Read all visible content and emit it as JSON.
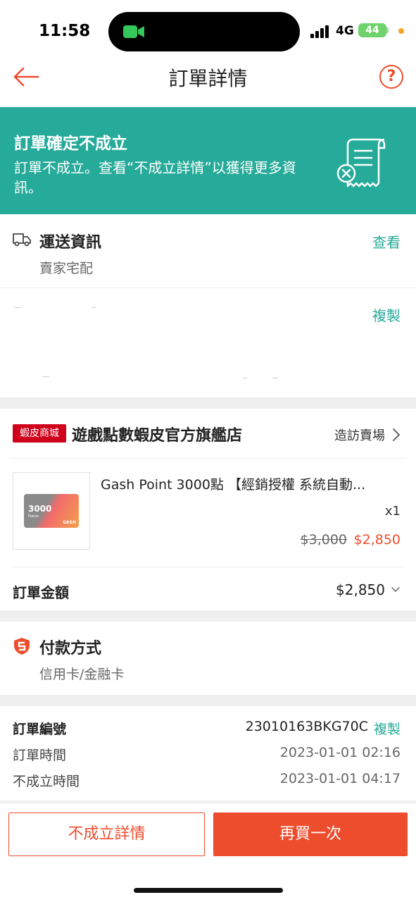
{
  "status_bar": {
    "time": "11:58",
    "network": "4G",
    "battery": "44",
    "icons": [
      "facetime-icon",
      "signal-icon",
      "battery-icon"
    ]
  },
  "header": {
    "title": "訂單詳情",
    "icons": [
      "back-arrow-icon",
      "help-icon"
    ],
    "help_glyph": "?"
  },
  "banner": {
    "title": "訂單確定不成立",
    "text": "訂單不成立。查看“不成立詳情”以獲得更多資訊。",
    "icon": "cancelled-receipt-icon",
    "color": "#26aa99"
  },
  "shipping": {
    "title": "運送資訊",
    "view_label": "查看",
    "method": "賣家宅配",
    "copy_label": "複製",
    "icon": "truck-icon"
  },
  "shop": {
    "badge": "蝦皮商城",
    "name": "遊戲點數蝦皮官方旗艦店",
    "visit_label": "造訪賣場",
    "product": {
      "name": "Gash Point 3000點 【經銷授權 系統自動...",
      "image_text": "3000",
      "image_sub": "Points",
      "image_brand": "GASH",
      "quantity": "x1",
      "original_price": "$3,000",
      "price": "$2,850"
    },
    "total_label": "訂單金額",
    "total_value": "$2,850"
  },
  "payment": {
    "title": "付款方式",
    "method": "信用卡/金融卡",
    "icon": "shield-icon"
  },
  "order_info": {
    "number_label": "訂單編號",
    "number_value": "23010163BKG70C",
    "copy_label": "複製",
    "time_label": "訂單時間",
    "time_value": "2023-01-01 02:16",
    "cancel_time_label": "不成立時間",
    "cancel_time_value": "2023-01-01 04:17"
  },
  "footer": {
    "details_button": "不成立詳情",
    "buy_again_button": "再買一次"
  },
  "colors": {
    "accent": "#ee4d2d",
    "teal": "#26aa99",
    "mall_red": "#d0011b"
  }
}
